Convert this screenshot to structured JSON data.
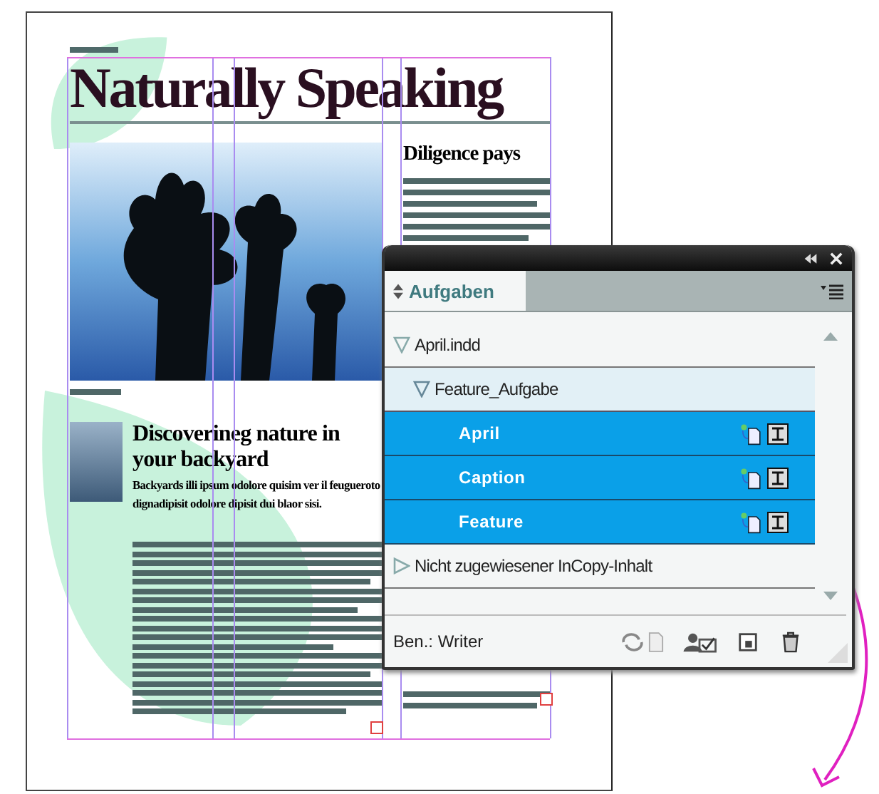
{
  "document": {
    "masthead": "Naturally Speaking",
    "sidebar_heading": "Diligence pays",
    "story_heading": "Discoverineg nature in your backyard",
    "story_body": "Backyards illi ipsum odolore quisim ver il feugueroto dignadipisit odolore dipisit dui blaor sisi."
  },
  "panel": {
    "tab": "Aufgaben",
    "tree": [
      {
        "label": "April.indd",
        "expanded": true,
        "selected": false,
        "children": [
          {
            "label": "Feature_Aufgabe",
            "expanded": true,
            "selected": false,
            "children": [
              {
                "label": "April",
                "selected": true
              },
              {
                "label": "Caption",
                "selected": true
              },
              {
                "label": "Feature",
                "selected": true
              }
            ]
          }
        ]
      },
      {
        "label": "Nicht zugewiesener InCopy-Inhalt",
        "expanded": false,
        "selected": false
      }
    ],
    "user": "Ben.: Writer"
  }
}
